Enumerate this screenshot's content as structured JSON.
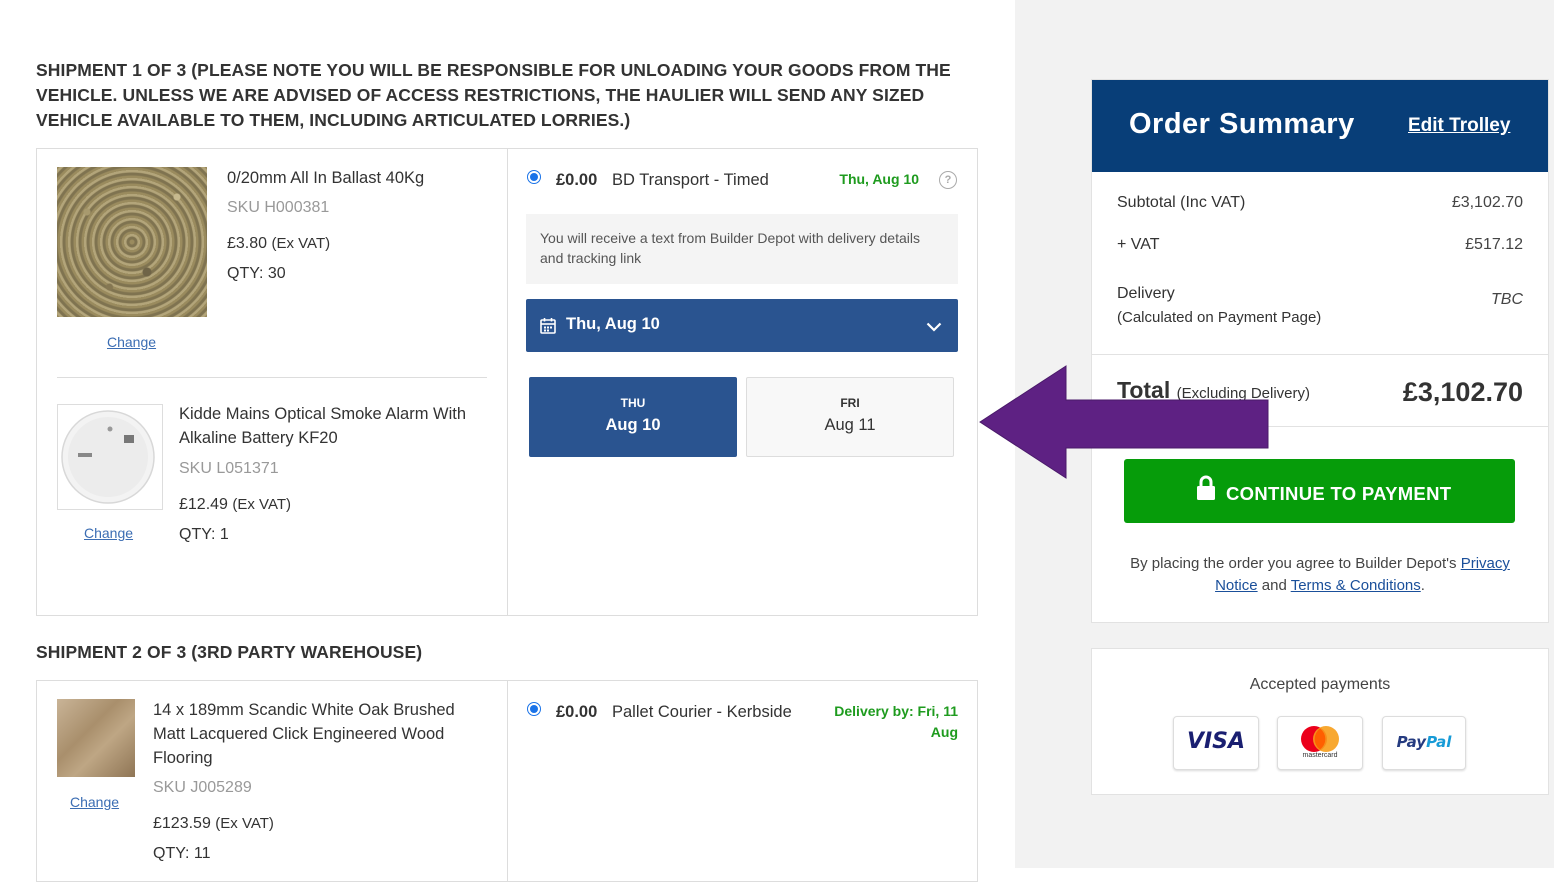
{
  "shipment1": {
    "heading": "SHIPMENT 1 OF 3 (PLEASE NOTE YOU WILL BE RESPONSIBLE FOR UNLOADING YOUR GOODS FROM THE VEHICLE. UNLESS WE ARE ADVISED OF ACCESS RESTRICTIONS, THE HAULIER WILL SEND ANY SIZED VEHICLE AVAILABLE TO THEM, INCLUDING ARTICULATED LORRIES.)",
    "items": [
      {
        "name": "0/20mm All In Ballast 40Kg",
        "sku": "SKU H000381",
        "price": "£3.80",
        "vat_note": "(Ex VAT)",
        "qty": "QTY: 30",
        "change": "Change"
      },
      {
        "name": "Kidde Mains Optical Smoke Alarm With Alkaline Battery KF20",
        "sku": "SKU L051371",
        "price": "£12.49",
        "vat_note": "(Ex VAT)",
        "qty": "QTY: 1",
        "change": "Change"
      }
    ],
    "delivery_option": {
      "price": "£0.00",
      "name": "BD Transport - Timed",
      "date": "Thu, Aug 10",
      "help_icon": "question-circle-icon"
    },
    "info_note": "You will receive a text from Builder Depot with delivery details and tracking link",
    "date_dropdown": {
      "value": "Thu, Aug 10",
      "icon": "calendar-icon"
    },
    "day_tiles": [
      {
        "weekday": "THU",
        "date": "Aug 10",
        "selected": true
      },
      {
        "weekday": "FRI",
        "date": "Aug 11",
        "selected": false
      }
    ]
  },
  "shipment2": {
    "heading": "SHIPMENT 2 OF 3 (3RD PARTY WAREHOUSE)",
    "items": [
      {
        "name": "14 x 189mm Scandic White Oak Brushed Matt Lacquered Click Engineered Wood Flooring",
        "sku": "SKU J005289",
        "price": "£123.59",
        "vat_note": "(Ex VAT)",
        "qty": "QTY: 11",
        "change": "Change"
      }
    ],
    "delivery_option": {
      "price": "£0.00",
      "name": "Pallet Courier - Kerbside",
      "date_line1": "Delivery by: Fri, 11",
      "date_line2": "Aug"
    }
  },
  "summary": {
    "title": "Order Summary",
    "edit_link": "Edit Trolley",
    "subtotal_label": "Subtotal (Inc VAT)",
    "subtotal_value": "£3,102.70",
    "vat_label": "+ VAT",
    "vat_value": "£517.12",
    "delivery_label": "Delivery",
    "delivery_sub": "(Calculated on Payment Page)",
    "delivery_value": "TBC",
    "total_label": "Total",
    "total_sub": "(Excluding Delivery)",
    "total_value": "£3,102.70",
    "pay_button": "CONTINUE TO PAYMENT",
    "legal_prefix": "By placing the order you agree to Builder Depot's",
    "privacy_link": "Privacy Notice",
    "legal_and": "and",
    "terms_link": "Terms & Conditions",
    "legal_suffix": "."
  },
  "payments": {
    "title": "Accepted payments",
    "cards": [
      "VISA",
      "mastercard",
      "PayPal"
    ],
    "paypal_pay": "Pay",
    "paypal_pal": "Pal"
  },
  "colors": {
    "brand_navy": "#083e78",
    "selected_blue": "#2a5490",
    "pay_green": "#069c0a",
    "date_green": "#1e9b1e",
    "annotation_arrow": "#5e2183"
  }
}
